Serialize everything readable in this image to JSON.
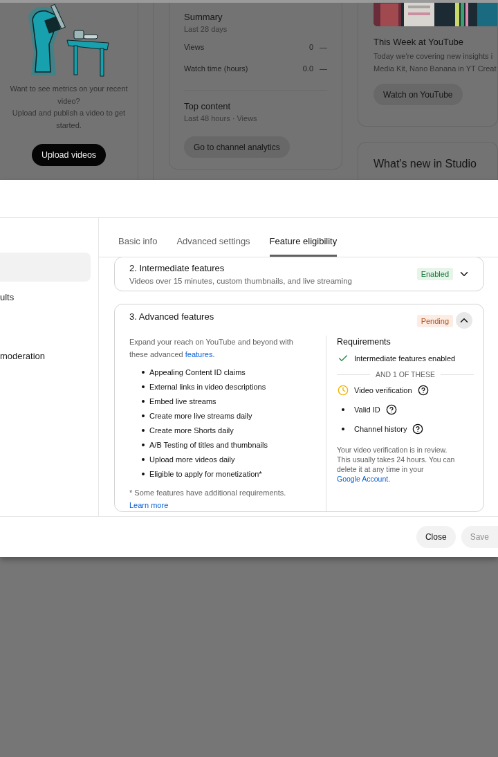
{
  "dashboard": {
    "upload_card": {
      "message": "Want to see metrics on your recent video?",
      "hint": "Upload and publish a video to get started.",
      "button": "Upload videos"
    },
    "analytics_card": {
      "summary_title": "Summary",
      "summary_period": "Last 28 days",
      "metrics": [
        {
          "label": "Views",
          "value": "0",
          "trend": "—"
        },
        {
          "label": "Watch time (hours)",
          "value": "0.0",
          "trend": "—"
        }
      ],
      "top_content_title": "Top content",
      "top_content_period": "Last 48 hours · Views",
      "button": "Go to channel analytics"
    },
    "news_card": {
      "picture": {
        "kind": "picture"
      },
      "title": "This Week at YouTube",
      "text_lines": [
        "Today we're covering new insights i",
        "Media Kit, Nano Banana in YT Creat"
      ],
      "button": "Watch on YouTube"
    },
    "whats_new_card": {
      "title": "What's new in Studio"
    }
  },
  "dialog": {
    "sidebar": {
      "items": [
        {
          "selected": true
        },
        {
          "label": "ults",
          "selected": false
        },
        {
          "label": "moderation",
          "selected": false
        }
      ]
    },
    "tabs": [
      {
        "label": "Basic info",
        "selected": false
      },
      {
        "label": "Advanced settings",
        "selected": false
      },
      {
        "label": "Feature eligibility",
        "selected": true
      }
    ],
    "features": [
      {
        "title": "2. Intermediate features",
        "subtitle": "Videos over 15 minutes, custom thumbnails, and live streaming",
        "status": "Enabled",
        "kind": "enabled",
        "expanded": false
      },
      {
        "title": "3. Advanced features",
        "status": "Pending",
        "kind": "pending",
        "expanded": true,
        "intro": "Expand your reach on YouTube and beyond with these advanced",
        "intro_link": "features.",
        "bullets": [
          "Appealing Content ID claims",
          "External links in video descriptions",
          "Embed live streams",
          "Create more live streams daily",
          "Create more Shorts daily",
          "A/B Testing of titles and thumbnails",
          "Upload more videos daily",
          "Eligible to apply for monetization*"
        ],
        "footnote": "* Some features have additional requirements.",
        "footnote_link": "Learn more",
        "requirements": {
          "title": "Requirements",
          "items": [
            {
              "label": "Intermediate features enabled",
              "kind": "done"
            }
          ],
          "divider": "AND 1 OF THESE",
          "options": [
            {
              "label": "Video verification",
              "kind": "pending",
              "help": true
            },
            {
              "label": "Valid ID",
              "kind": "bullet",
              "help": true
            },
            {
              "label": "Channel history",
              "kind": "bullet",
              "help": true
            }
          ],
          "note": "Your video verification is in review. This usually takes 24 hours. You can delete it at any time in your",
          "note_link": "Google Account."
        }
      }
    ],
    "buttons": [
      {
        "label": "Close",
        "disabled": false
      },
      {
        "label": "Save",
        "disabled": true
      }
    ]
  }
}
